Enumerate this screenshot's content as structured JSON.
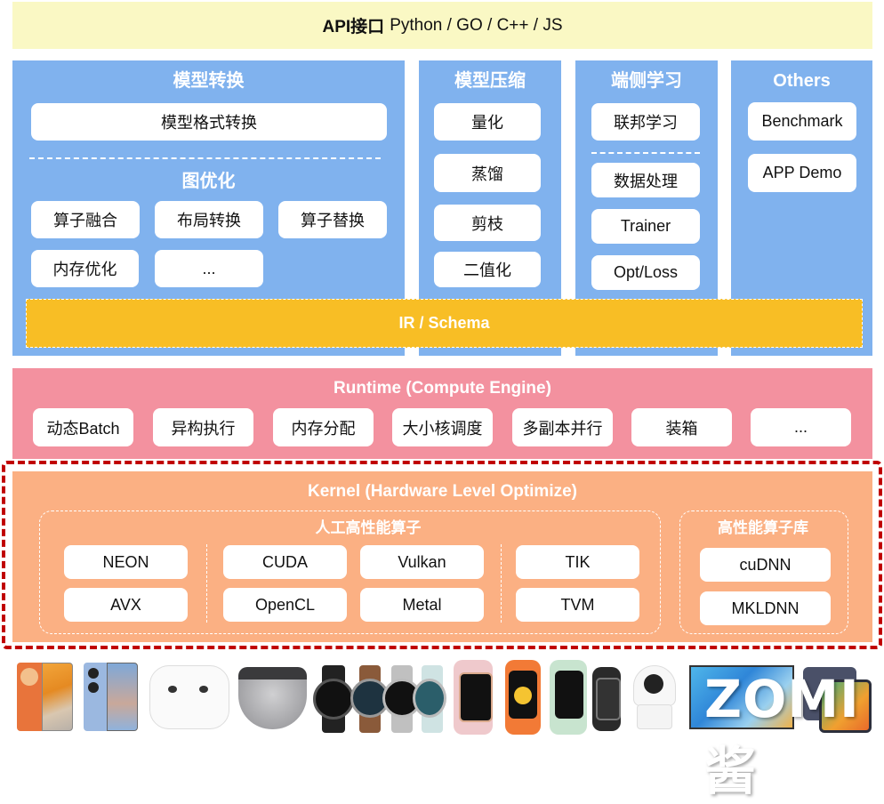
{
  "api_bar": {
    "label": "API接口",
    "languages": "Python / GO / C++ / JS"
  },
  "frontend": {
    "model_conversion": {
      "title": "模型转换",
      "format_conversion": "模型格式转换",
      "graph_opt_title": "图优化",
      "graph_opt_items": [
        "算子融合",
        "布局转换",
        "算子替换",
        "内存优化",
        "..."
      ]
    },
    "model_compression": {
      "title": "模型压缩",
      "items": [
        "量化",
        "蒸馏",
        "剪枝",
        "二值化"
      ]
    },
    "on_device_learning": {
      "title": "端侧学习",
      "federated": "联邦学习",
      "items": [
        "数据处理",
        "Trainer",
        "Opt/Loss"
      ]
    },
    "others": {
      "title": "Others",
      "items": [
        "Benchmark",
        "APP Demo"
      ]
    },
    "ir": "IR / Schema"
  },
  "runtime": {
    "title": "Runtime (Compute Engine)",
    "items": [
      "动态Batch",
      "异构执行",
      "内存分配",
      "大小核调度",
      "多副本并行",
      "装箱",
      "..."
    ]
  },
  "kernel": {
    "title": "Kernel (Hardware Level Optimize)",
    "manual_ops": {
      "title": "人工高性能算子",
      "items": [
        "NEON",
        "AVX",
        "CUDA",
        "OpenCL",
        "Vulkan",
        "Metal",
        "TIK",
        "TVM"
      ]
    },
    "libraries": {
      "title": "高性能算子库",
      "items": [
        "cuDNN",
        "MKLDNN"
      ]
    }
  },
  "devices": [
    "smartphone-orange",
    "smartphone-blue",
    "earbuds-white",
    "earbuds-grey",
    "smartwatches",
    "fitness-bands",
    "smart-camera",
    "smart-tv",
    "tablet"
  ],
  "watermark": "ZOMI酱",
  "colors": {
    "api_bar": "#faf8c4",
    "frontend_blue": "#80b2ee",
    "ir_yellow": "#f8be25",
    "runtime_pink": "#f3919f",
    "kernel_orange": "#fbb083",
    "highlight_red": "#c00000"
  }
}
